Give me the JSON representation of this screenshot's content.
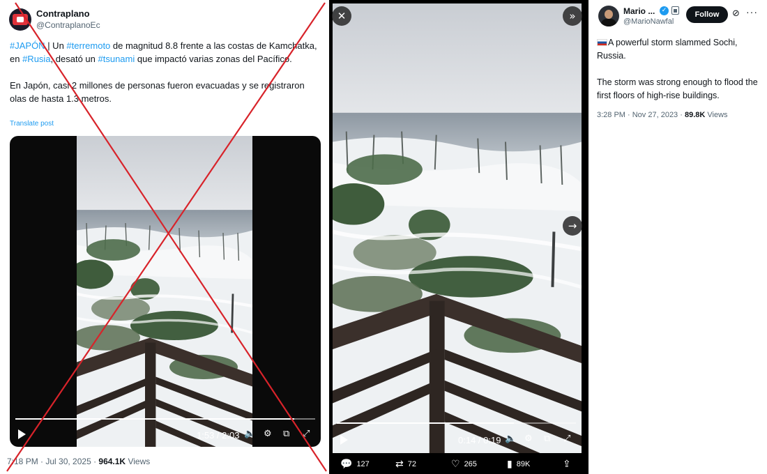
{
  "left_post": {
    "display_name": "Contraplano",
    "handle": "@ContraplanoEc",
    "text_p1_parts": [
      "#JAPÓN",
      " | Un ",
      "#terremoto",
      " de magnitud 8.8 frente a las costas de Kamchatka, en ",
      "#Rusia",
      ", desató un ",
      "#tsunami",
      " que impactó varias zonas del Pacífico."
    ],
    "text_p2": "En Japón, casi 2 millones de personas fueron evacuadas y se registraron olas de hasta 1.3 metros.",
    "translate_label": "Translate post",
    "video_time": "1:53 / 2:03",
    "video_progress": 0.93,
    "timestamp": "7:18 PM · Jul 30, 2025 · ",
    "views_count": "964.1K",
    "views_label": "Views"
  },
  "viewer": {
    "video_time": "0:14 / 0:19",
    "video_progress": 0.74,
    "close_icon_glyph": "✕",
    "expand_icon_glyph": "»",
    "next_icon_glyph": "→",
    "actions": {
      "replies": "127",
      "reposts": "72",
      "likes": "265",
      "views": "89K"
    }
  },
  "right_post": {
    "display_name": "Mario ...",
    "handle": "@MarioNawfal",
    "follow_label": "Follow",
    "text_p1": "A powerful storm slammed Sochi, Russia.",
    "text_p2": "The storm was strong enough to flood the first floors of high-rise buildings.",
    "timestamp": "3:28 PM · Nov 27, 2023 · ",
    "views_count": "89.8K",
    "views_label": "Views"
  },
  "colors": {
    "link_blue": "#1d9bf0",
    "cross_red": "#d8232a",
    "text_dark": "#0f1419",
    "text_muted": "#536471"
  }
}
